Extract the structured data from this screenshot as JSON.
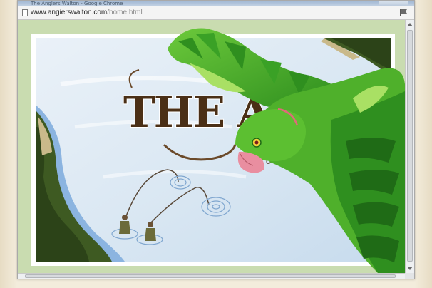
{
  "browser": {
    "title": "The Anglers Walton - Google Chrome",
    "address": {
      "domain": "www.angierswalton.com",
      "path": "/home.html"
    }
  },
  "page": {
    "banner_text": "THE ANGL",
    "banner_subtext": "ON"
  },
  "icons": {
    "page": "page-icon",
    "feed": "feed-icon",
    "scroll_up": "chevron-up-icon",
    "scroll_down": "chevron-down-icon"
  },
  "colors": {
    "page_background": "#c9dcb0",
    "bird_green": "#4fb02b",
    "bird_dark": "#1f6b16",
    "title_brown": "#4a2f16",
    "river": "#8bb4e0"
  }
}
